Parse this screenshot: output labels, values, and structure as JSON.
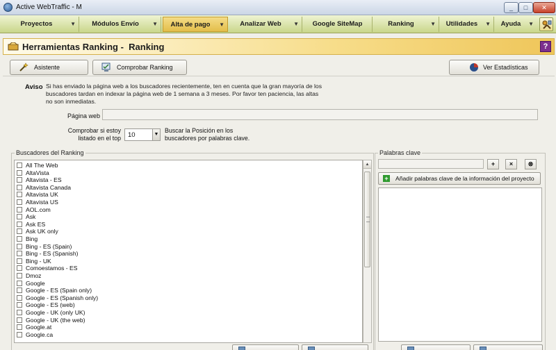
{
  "window": {
    "title": "Active WebTraffic - M",
    "buttons": {
      "minimize": "_",
      "maximize": "□",
      "close": "✕"
    }
  },
  "menu": {
    "items": [
      {
        "label": "Proyectos",
        "active": false
      },
      {
        "label": "Módulos Envío",
        "active": false
      },
      {
        "label": "Alta de pago",
        "active": true
      },
      {
        "label": "Analizar Web",
        "active": false
      },
      {
        "label": "Google SiteMap",
        "active": false
      },
      {
        "label": "Ranking",
        "active": false
      },
      {
        "label": "Utilidades",
        "active": false
      },
      {
        "label": "Ayuda",
        "active": false
      }
    ]
  },
  "section": {
    "title": "Herramientas Ranking -  Ranking",
    "help": "?"
  },
  "toolbar": {
    "asistente": "Asistente",
    "comprobar": "Comprobar Ranking",
    "estadisticas": "Ver Estadísticas"
  },
  "aviso": {
    "label": "Aviso",
    "text": "Si has enviado la página web a los buscadores recientemente, ten en cuenta que la gran mayoría de los buscadores tardan en indexar la página web de 1 semana a 3 meses. Por favor ten paciencia, las altas no son inmediatas."
  },
  "form": {
    "pagina_web_label": "Página web",
    "pagina_web_value": "",
    "top_label": "Comprobar si estoy listado en el top",
    "top_value": "10",
    "search_label": "Buscar la Posición en los buscadores por palabras clave."
  },
  "engines": {
    "group_title": "Buscadores del Ranking",
    "items": [
      "All The Web",
      "AltaVista",
      "Altavista - ES",
      "Altavista Canada",
      "Altavista UK",
      "Altavista US",
      "AOL.com",
      "Ask",
      "Ask ES",
      "Ask UK only",
      "Bing",
      "Bing - ES (Spain)",
      "Bing - ES (Spanish)",
      "Bing - UK",
      "Comoestamos - ES",
      "Dmoz",
      "Google",
      "Google - ES (Spain only)",
      "Google - ES (Spanish only)",
      "Google - ES (web)",
      "Google - UK (only UK)",
      "Google - UK (the web)",
      "Google.at",
      "Google.ca"
    ]
  },
  "keywords": {
    "group_title": "Palabras clave",
    "input_value": "",
    "add_from_project": "Añadir palabras clave de la información del proyecto",
    "btn_add": "+",
    "btn_remove": "×",
    "btn_clear": "⊗"
  },
  "colors": {
    "menu_bg": "#c9d68a",
    "active_menu": "#e3be4a",
    "header_bg": "#f7dd8a",
    "help_purple": "#7c2f8e"
  }
}
